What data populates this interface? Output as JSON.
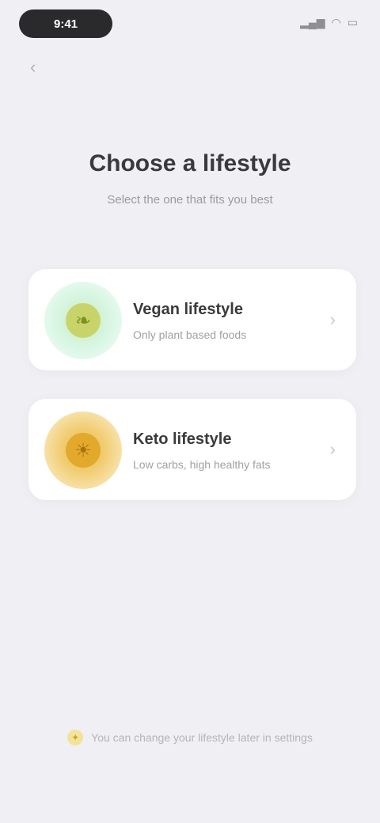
{
  "status_bar": {
    "time": "9:41",
    "signal_icon": "signal-icon",
    "wifi_icon": "wifi-icon",
    "battery_icon": "battery-icon"
  },
  "nav": {
    "back_icon": "chevron-left-icon"
  },
  "header": {
    "title": "Choose a lifestyle",
    "subtitle": "Select the one that fits you best"
  },
  "options": [
    {
      "title": "Vegan lifestyle",
      "description": "Only plant based foods",
      "icon": "leaf-icon",
      "accent": "#d6f5e1"
    },
    {
      "title": "Keto lifestyle",
      "description": "Low carbs, high healthy fats",
      "icon": "sun-icon",
      "accent": "#f1cd73"
    }
  ],
  "footer": {
    "icon": "lightbulb-icon",
    "text": "You can change your lifestyle later in settings"
  }
}
